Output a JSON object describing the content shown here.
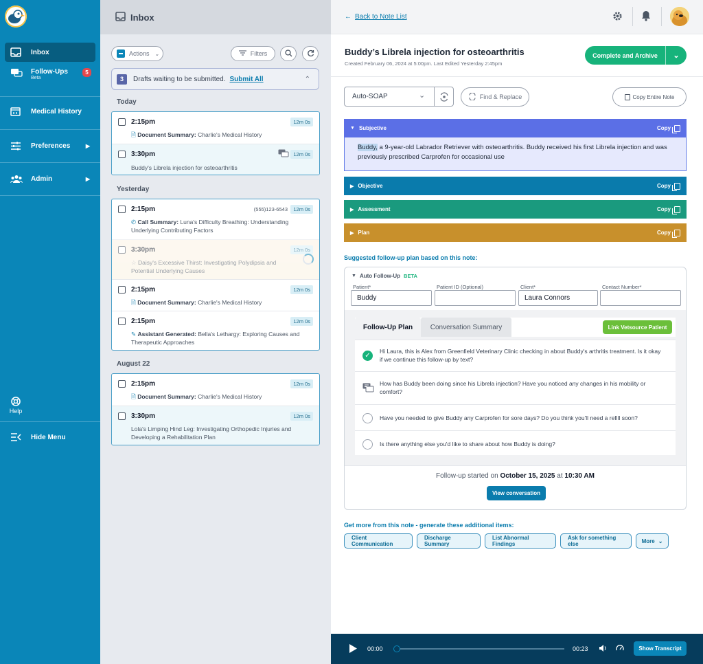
{
  "sidebar": {
    "items": [
      {
        "label": "Inbox",
        "icon": "inbox-icon"
      },
      {
        "label": "Follow-Ups",
        "sub": "Beta",
        "badge": "5",
        "icon": "chat-icon"
      },
      {
        "label": "Medical History",
        "icon": "calendar-icon"
      },
      {
        "label": "Preferences",
        "icon": "sliders-icon"
      },
      {
        "label": "Admin",
        "icon": "people-icon"
      }
    ],
    "help": "Help",
    "hide_menu": "Hide Menu"
  },
  "inbox": {
    "title": "Inbox",
    "actions_label": "Actions",
    "filters_label": "Filters",
    "drafts": {
      "count": "3",
      "text": "Drafts waiting to be submitted.",
      "link": "Submit All"
    },
    "sections": [
      {
        "label": "Today",
        "items": [
          {
            "time": "2:15pm",
            "duration": "12m 0s",
            "kind": "Document Summary:",
            "text": "Charlie's Medical History"
          },
          {
            "time": "3:30pm",
            "duration": "12m 0s",
            "text": "Buddy's Librela injection for osteoarthritis"
          }
        ]
      },
      {
        "label": "Yesterday",
        "items": [
          {
            "time": "2:15pm",
            "duration": "12m 0s",
            "phone": "(555)123-6543",
            "kind": "Call Summary:",
            "text": "Luna's Difficulty Breathing: Understanding Underlying Contributing Factors"
          },
          {
            "time": "3:30pm",
            "duration": "12m 0s",
            "text": "Daisy's Excessive Thirst: Investigating Polydipsia and Potential Underlying Causes"
          },
          {
            "time": "2:15pm",
            "duration": "12m 0s",
            "kind": "Document Summary:",
            "text": "Charlie's Medical History"
          },
          {
            "time": "2:15pm",
            "duration": "12m 0s",
            "kind": "Assistant Generated:",
            "text": "Bella's Lethargy: Exploring Causes and Therapeutic Approaches"
          }
        ]
      },
      {
        "label": "August 22",
        "items": [
          {
            "time": "2:15pm",
            "duration": "12m 0s",
            "kind": "Document Summary:",
            "text": "Charlie's Medical History"
          },
          {
            "time": "3:30pm",
            "duration": "12m 0s",
            "text": "Lola's Limping Hind Leg: Investigating Orthopedic Injuries and Developing a Rehabilitation Plan"
          }
        ]
      }
    ]
  },
  "note": {
    "back_label": "Back to Note List",
    "title": "Buddy’s Librela injection for osteoarthritis",
    "subtitle": "Created February 06, 2024 at 5:00pm. Last Edited Yesterday 2:45pm",
    "complete_label": "Complete and Archive",
    "template_select": "Auto-SOAP",
    "find_replace": "Find & Replace",
    "copy_all": "Copy Entire Note",
    "copy_label": "Copy",
    "sections": [
      {
        "label": "Subjective",
        "color": "#5b6fe6"
      },
      {
        "label": "Objective",
        "color": "#0a7bac"
      },
      {
        "label": "Assessment",
        "color": "#1a9a7e"
      },
      {
        "label": "Plan",
        "color": "#c8902c"
      }
    ],
    "subjective_highlight": "Buddy,",
    "subjective_text": " a 9-year-old Labrador Retriever with osteoarthritis. Buddy received his first Librela injection and was previously prescribed Carprofen for occasional use"
  },
  "followup": {
    "heading": "Suggested follow-up plan based on this note:",
    "auto_label": "Auto Follow-Up",
    "beta": "BETA",
    "fields": {
      "patient_label": "Patient*",
      "patient_value": "Buddy",
      "patient_id_label": "Patient ID (Optional)",
      "patient_id_value": "",
      "client_label": "Client*",
      "client_value": "Laura Connors",
      "contact_label": "Contact Number*",
      "contact_value": ""
    },
    "tabs": [
      "Follow-Up Plan",
      "Conversation Summary"
    ],
    "link_button": "Link Vetsource Patient",
    "messages": [
      {
        "text": "Hi Laura, this is Alex from Greenfield Veterinary Clinic checking in about Buddy's arthritis treatment. Is it okay if we continue this follow-up by text?"
      },
      {
        "text": "How has Buddy been doing since his Librela injection? Have you noticed any changes in his mobility or comfort?"
      },
      {
        "text": "Have you needed to give Buddy any Carprofen for sore days? Do you think you'll need a refill soon?"
      },
      {
        "text": "Is there anything else you'd like to share about how Buddy is doing?"
      }
    ],
    "started_prefix": "Follow-up started on",
    "started_date": "October 15, 2025",
    "started_at": "at",
    "started_time": "10:30 AM",
    "view_button": "View conversation"
  },
  "more": {
    "heading": "Get more from this note - generate these additional items:",
    "chips": [
      "Client Communication",
      "Discharge Summary",
      "List Abnormal Findings",
      "Ask for something else",
      "More"
    ]
  },
  "player": {
    "current": "00:00",
    "total": "00:23",
    "transcript": "Show Transcript",
    "progress": 0.0
  }
}
